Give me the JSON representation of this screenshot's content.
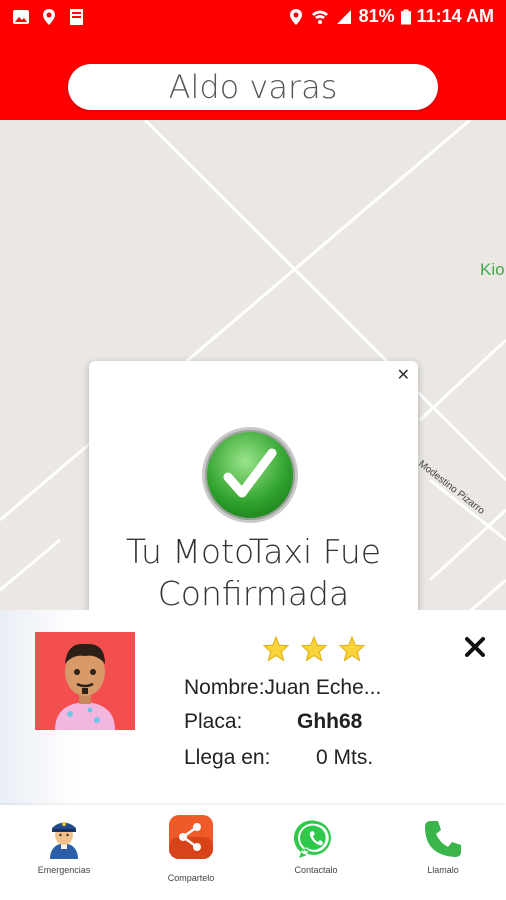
{
  "status_bar": {
    "battery": "81%",
    "time": "11:14 AM"
  },
  "search": {
    "value": "Aldo varas"
  },
  "map": {
    "labels": {
      "kio": "Kio",
      "street": "de Modestino Pizarro"
    }
  },
  "dialog": {
    "close_icon": "close-icon",
    "message_line1": "Tu MotoTaxi Fue",
    "message_line2": "Confirmada"
  },
  "driver": {
    "rating_stars": 3,
    "name_label": "Nombre:",
    "name_value": "Juan Eche...",
    "plate_label": "Placa:",
    "plate_value": "Ghh68",
    "eta_label": "Llega en:",
    "eta_value": "0 Mts."
  },
  "bottom_nav": {
    "emergency": "Emergencias",
    "share": "Compartelo",
    "whatsapp": "Contactalo",
    "call": "Llamalo"
  },
  "colors": {
    "header": "#ff0000",
    "map_bg": "#ebe8e3",
    "avatar_bg": "#f44f4f",
    "star": "#f9d33b"
  }
}
